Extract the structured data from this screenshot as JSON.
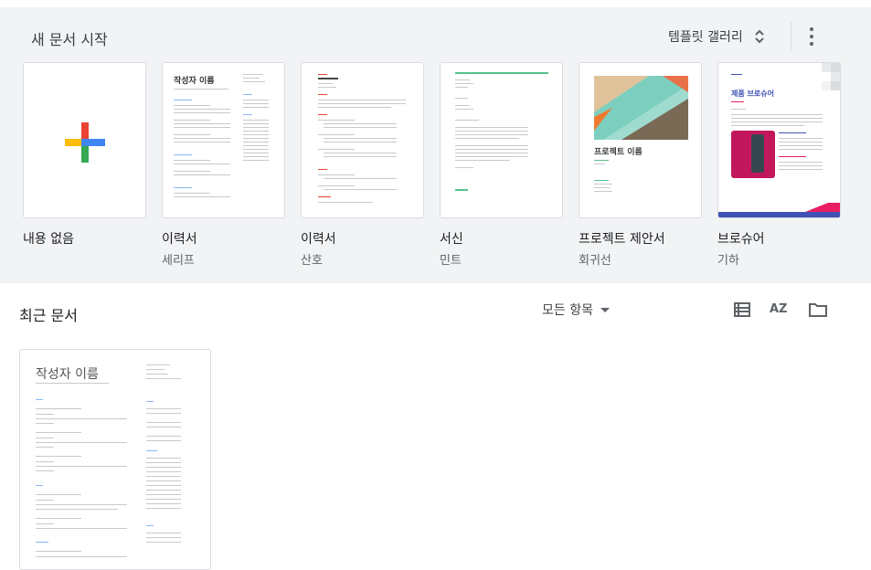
{
  "start": {
    "title": "새 문서 시작",
    "gallery_label": "템플릿 갤러리",
    "templates": [
      {
        "name": "내용 없음",
        "sub": ""
      },
      {
        "name": "이력서",
        "sub": "세리프"
      },
      {
        "name": "이력서",
        "sub": "산호"
      },
      {
        "name": "서신",
        "sub": "민트"
      },
      {
        "name": "프로젝트 제안서",
        "sub": "회귀선"
      },
      {
        "name": "브로슈어",
        "sub": "기하"
      }
    ],
    "thumb_text": {
      "resume_name": "작성자 이름",
      "project_title": "프로젝트 이름",
      "brochure_title": "제품 브로슈어"
    }
  },
  "recent": {
    "title": "최근 문서",
    "filter_label": "모든 항목",
    "doc_title": "작성자 이름"
  },
  "icons": {
    "plus": "plus-multicolor-icon",
    "sort": "sort-updown-icon",
    "more": "more-vert-icon",
    "list": "list-view-icon",
    "az": "sort-az-icon",
    "folder": "folder-icon"
  },
  "colors": {
    "google_blue": "#4285F4",
    "google_red": "#EA4335",
    "google_yellow": "#FBBC05",
    "google_green": "#34A853",
    "panel_bg": "#f1f3f4"
  }
}
